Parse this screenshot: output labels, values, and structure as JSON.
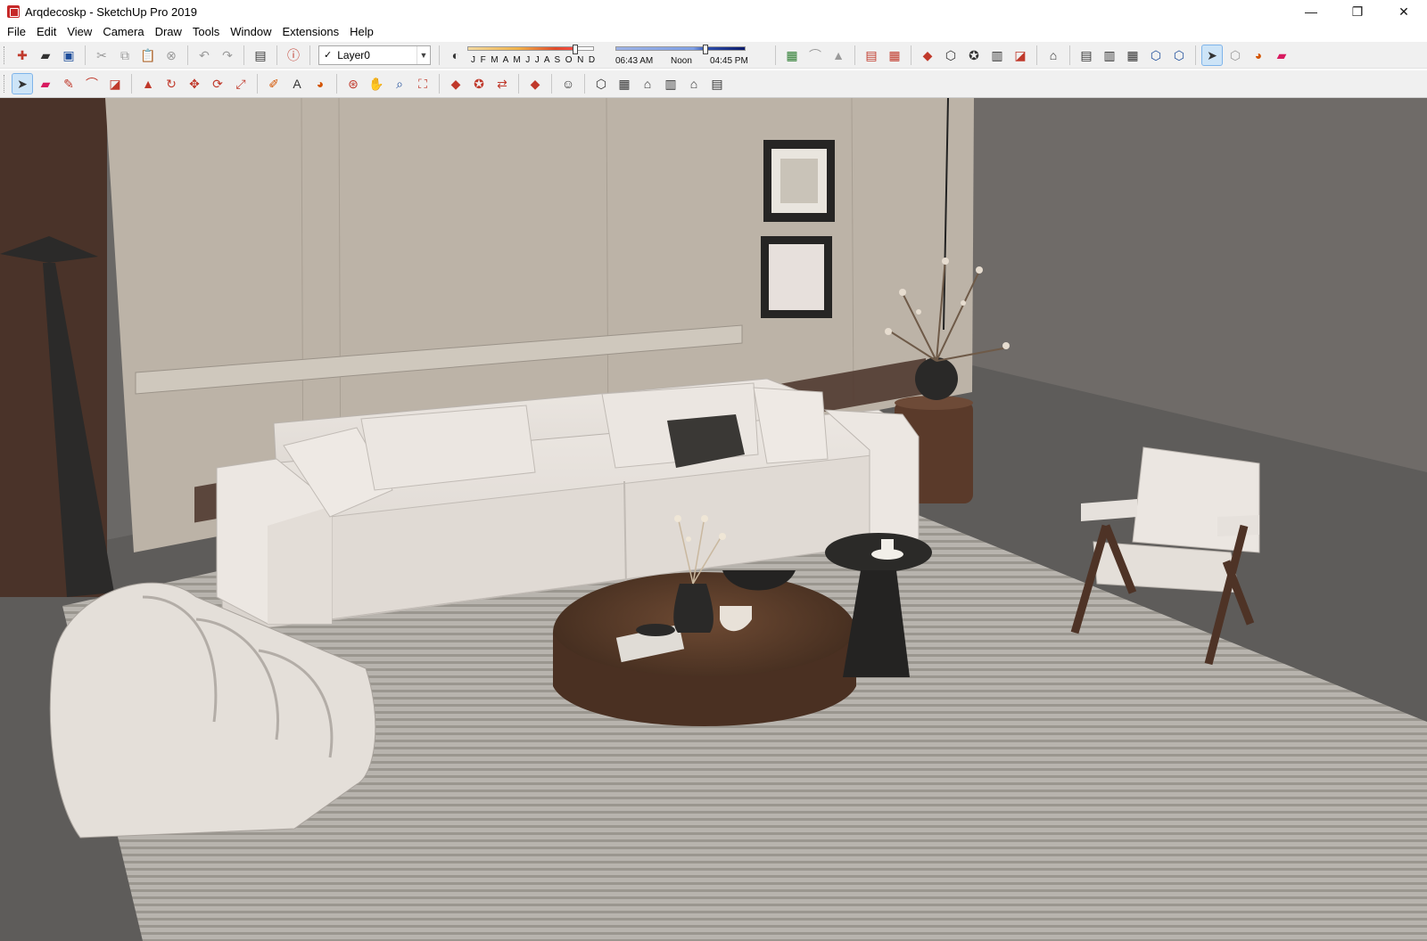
{
  "window": {
    "title": "Arqdecoskp - SketchUp Pro 2019"
  },
  "menu": [
    "File",
    "Edit",
    "View",
    "Camera",
    "Draw",
    "Tools",
    "Window",
    "Extensions",
    "Help"
  ],
  "layers": {
    "current": "Layer0"
  },
  "shadows": {
    "months": "J F M A M J J A S O N D",
    "time_start": "06:43 AM",
    "time_mid": "Noon",
    "time_end": "04:45 PM"
  },
  "icons": {
    "win_min": "—",
    "win_max": "❐",
    "win_close": "✕",
    "new": "✚",
    "open": "▰",
    "save": "▣",
    "cut": "✂",
    "copy": "⧉",
    "paste": "📋",
    "erase": "⊗",
    "undo": "↶",
    "redo": "↷",
    "print": "▤",
    "model_info": "ⓘ",
    "shadow_toggle": "◐",
    "select": "➤",
    "eraser": "▰",
    "pencil": "✎",
    "arc": "⌒",
    "shape": "◪",
    "push_pull": "▲",
    "follow_me": "↻",
    "move": "✥",
    "rotate": "⟳",
    "scale": "⤢",
    "tape": "✐",
    "text": "A",
    "paint": "◕",
    "orbit": "⊛",
    "pan": "✋",
    "zoom": "⌕",
    "zoom_ext": "⛶",
    "warehouse": "◆",
    "extension_wh": "✪",
    "send_layout": "⇄",
    "ruby": "◆",
    "user": "☺",
    "view_iso": "⬡",
    "view_top": "▦",
    "view_front": "⌂",
    "view_right": "▥",
    "view_back": "⌂",
    "view_left": "▤"
  },
  "colors": {
    "toolbar_bg": "#f0f0f0",
    "selected_tool": "#cde4f7",
    "brand_red": "#c62828"
  }
}
